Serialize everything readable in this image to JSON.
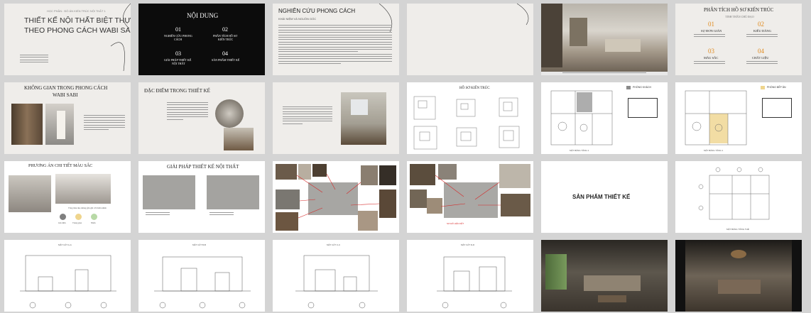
{
  "slide1": {
    "header": "HỌC PHẦN : ĐỒ ÁN KIẾN TRÚC NỘI THẤT 1",
    "title_line1": "THIẾT KẾ NỘI THẤT BIỆT THỰ",
    "title_line2": "THEO PHONG CÁCH WABI SABI"
  },
  "slide2": {
    "title": "NỘI DUNG",
    "items": [
      {
        "num": "01",
        "label1": "NGHIÊN CỨU PHONG",
        "label2": "CÁCH"
      },
      {
        "num": "02",
        "label1": "PHÂN TÍCH HỒ SƠ",
        "label2": "KIẾN TRÚC"
      },
      {
        "num": "03",
        "label1": "GIẢI PHÁP THIẾT KẾ",
        "label2": "NỘI THẤT"
      },
      {
        "num": "04",
        "label1": "SẢN PHẨM THIẾT KẾ",
        "label2": ""
      }
    ]
  },
  "slide3": {
    "title": "NGHIÊN CỨU PHONG CÁCH",
    "subtitle": "KHÁI NIỆM VÀ NGUỒN GỐC"
  },
  "slide6": {
    "title": "PHÂN TÍCH HỒ SƠ KIẾN TRÚC",
    "subtitle": "TINH THẦN CHỦ ĐẠO",
    "items": [
      {
        "num": "01",
        "label": "SỰ ĐƠN GIẢN"
      },
      {
        "num": "02",
        "label": "KIỂU DÁNG"
      },
      {
        "num": "03",
        "label": "MÀU SẮC"
      },
      {
        "num": "04",
        "label": "CHẤT LIỆU"
      }
    ]
  },
  "slide7": {
    "title_line1": "KHÔNG GIAN TRONG PHONG CÁCH",
    "title_line2": "WABI SABI"
  },
  "slide8": {
    "title": "ĐẶC ĐIỂM TRONG THIẾT KẾ"
  },
  "slide10": {
    "title": "HỒ SƠ KIẾN TRÚC"
  },
  "slide11": {
    "legend": "PHÒNG KHÁCH",
    "caption": "MẶT BẰNG TẦNG 1"
  },
  "slide12": {
    "legend": "PHÒNG BẾP ĂN",
    "caption": "MẶT BẰNG TẦNG 1"
  },
  "slide13": {
    "title": "PHƯƠNG ÁN CHI TIẾT MÀU SẮC",
    "caption": "Tông màu nhẹ nhàng gần gũi với thiên nhiên",
    "swatches": [
      {
        "label": "Ghi đậm",
        "color": "#7f7f7f"
      },
      {
        "label": "Trung gian",
        "color": "#efd58d"
      },
      {
        "label": "Nhấn",
        "color": "#b8d9a6"
      }
    ]
  },
  "slide14": {
    "title": "GIẢI PHÁP THIẾT KẾ NỘI THẤT"
  },
  "slide16": {
    "caption": "SƠ ĐỒ LIÊN KẾT"
  },
  "slide17": {
    "title": "SẢN PHẨM THIẾT KẾ"
  },
  "slide18": {
    "caption": "MẶT BẰNG TỔNG THỂ"
  },
  "slide19": {
    "caption": "MẶT CẮT A-A"
  },
  "slide20": {
    "caption": "MẶT CẮT B-B"
  },
  "slide21": {
    "caption": "MẶT CẮT C-C"
  },
  "slide22": {
    "caption": "MẶT CẮT D-D"
  }
}
